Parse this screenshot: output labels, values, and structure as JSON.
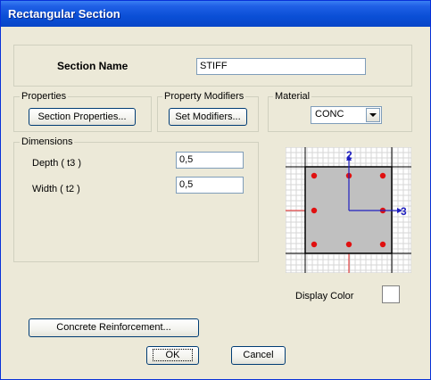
{
  "window": {
    "title": "Rectangular Section"
  },
  "section": {
    "name_label": "Section Name",
    "name_value": "STIFF"
  },
  "properties": {
    "group_label": "Properties",
    "button_label": "Section Properties..."
  },
  "modifiers": {
    "group_label": "Property Modifiers",
    "button_label": "Set Modifiers..."
  },
  "material": {
    "group_label": "Material",
    "selected": "CONC"
  },
  "dimensions": {
    "group_label": "Dimensions",
    "depth_label": "Depth  ( t3 )",
    "depth_value": "0,5",
    "width_label": "Width  ( t2 )",
    "width_value": "0,5"
  },
  "preview": {
    "axis_2_label": "2",
    "axis_3_label": "3"
  },
  "display_color": {
    "label": "Display Color",
    "swatch_color": "#ffffff"
  },
  "buttons": {
    "reinforcement_label": "Concrete Reinforcement...",
    "ok_label": "OK",
    "cancel_label": "Cancel"
  },
  "colors": {
    "rebar": "#e01010",
    "section_fill": "#c0c0c0",
    "axis": "#2020c0"
  }
}
